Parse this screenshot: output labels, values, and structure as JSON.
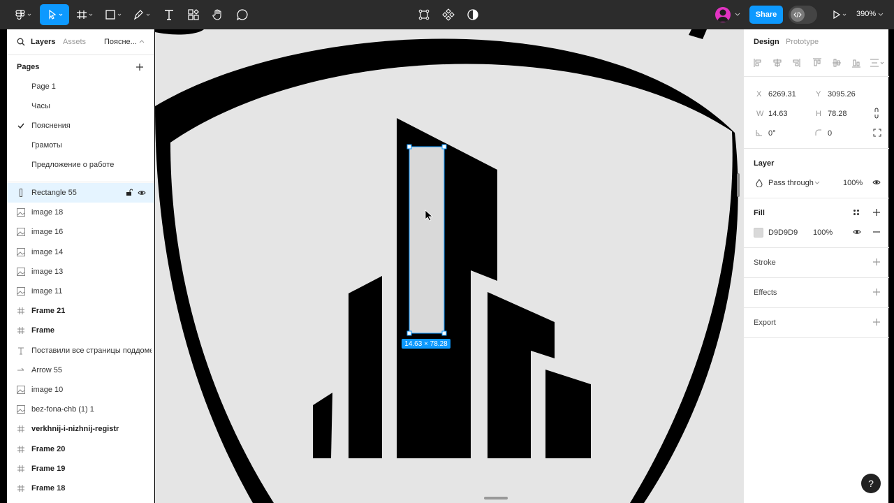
{
  "toolbar": {
    "share_label": "Share",
    "zoom_label": "390%"
  },
  "left_panel": {
    "tabs": [
      "Layers",
      "Assets",
      "Поясне..."
    ],
    "pages_title": "Pages",
    "pages": [
      {
        "label": "Page 1",
        "current": false
      },
      {
        "label": "Часы",
        "current": false
      },
      {
        "label": "Пояснения",
        "current": true
      },
      {
        "label": "Грамоты",
        "current": false
      },
      {
        "label": "Предложение о работе",
        "current": false
      }
    ],
    "layers": [
      {
        "label": "Rectangle 55",
        "kind": "rect",
        "selected": true
      },
      {
        "label": "image 18",
        "kind": "image"
      },
      {
        "label": "image 16",
        "kind": "image"
      },
      {
        "label": "image 14",
        "kind": "image"
      },
      {
        "label": "image 13",
        "kind": "image"
      },
      {
        "label": "image 11",
        "kind": "image"
      },
      {
        "label": "Frame 21",
        "kind": "frame"
      },
      {
        "label": "Frame",
        "kind": "frame"
      },
      {
        "label": "Поставили все страницы поддомена...",
        "kind": "text"
      },
      {
        "label": "Arrow 55",
        "kind": "arrow"
      },
      {
        "label": "image 10",
        "kind": "image"
      },
      {
        "label": "bez-fona-chb (1) 1",
        "kind": "image"
      },
      {
        "label": "verkhnij-i-nizhnij-registr",
        "kind": "frame"
      },
      {
        "label": "Frame 20",
        "kind": "frame"
      },
      {
        "label": "Frame 19",
        "kind": "frame"
      },
      {
        "label": "Frame 18",
        "kind": "frame"
      }
    ]
  },
  "canvas": {
    "size_tag": "14.63 × 78.28"
  },
  "right_panel": {
    "tabs": [
      "Design",
      "Prototype"
    ],
    "x_label": "X",
    "x_value": "6269.31",
    "y_label": "Y",
    "y_value": "3095.26",
    "w_label": "W",
    "w_value": "14.63",
    "h_label": "H",
    "h_value": "78.28",
    "rotation": "0°",
    "radius": "0",
    "layer_title": "Layer",
    "blend_mode": "Pass through",
    "opacity": "100%",
    "fill_title": "Fill",
    "fill_hex": "D9D9D9",
    "fill_opacity": "100%",
    "fill_color": "#d9d9d9",
    "stroke_title": "Stroke",
    "effects_title": "Effects",
    "export_title": "Export"
  },
  "colors": {
    "accent": "#0d99ff",
    "toolbar_bg": "#2c2c2c",
    "canvas_bg": "#e5e5e5"
  }
}
